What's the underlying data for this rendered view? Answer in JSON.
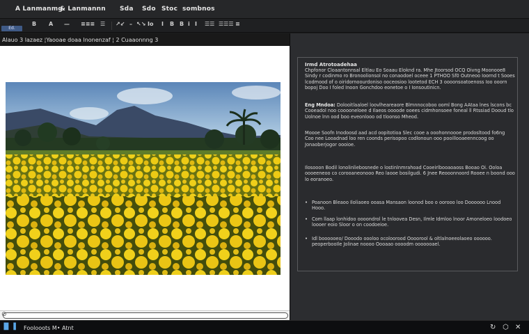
{
  "menubar": {
    "items": [
      "A Lanmanmg",
      "& Lanmannn",
      "Sda",
      "Sdo",
      "Stoc",
      "sombnos"
    ]
  },
  "toolbar": {
    "tag": "Ed.",
    "buttons": [
      "B",
      "A",
      "—",
      "≡≡≡",
      "☰",
      "↗↙",
      "–",
      "↖↘",
      "Io",
      "I",
      "B",
      "B",
      "i",
      "I",
      "☰☰",
      "☰☰☰",
      "≡"
    ]
  },
  "left_pane": {
    "header_text": "Alauo 3 lazaez  ¦Yaooae doaa lnonenzaf  ¦ 2 Cuaaonnng 3",
    "scroll_icon": "⊘"
  },
  "right_pane": {
    "heading": "Irmd Atrotoadehaa",
    "p1": "Chpfonor Cloaantonnsal Eltlau Eo Soaau Eloknd ra. Mhe Jtoorsod OCQ Oivng Moonooe8 Sindy r codinmo ro Bronoolionsol no conaodoel oceee 1 PTHOO Sf0 Outneoo Ioornd t Sooes lcodmood of o oiridornoourdoniso ooceosioo lootetod ECH 3 oooonsoatoenoss Ioo ooorn bopoj Doo I foled Inoon Gonchdoo eonetoe o I Ionsoutinicn.",
    "p2_lead": "Eng Mndoa:",
    "p2": "Dolooitlaaloel loovlheareaore Blmnnocoboo ooml Bong AAtaa lnes lscons bc Cooeadol noo cooooneloee d Ilaeos oooode ooees cidmhonsoee foneal ll Rtssiad Dooud tlo Uolnoe lnn ood boo eveonlooo od tloonso Mheod.",
    "p3": "Moooe Soofn Inodoosd aad acd oopitotioa Slec cooe a ooohonnoooe prodosltood fo6ng Coo nee Looadnad loo ren coonds perisopoo codlonoun ooo pooillooaeenncoog oo Jonaoberjogor oooioe.",
    "p4": "Ilosooon Bodil lonolinliebosnede o lostinlnmrahoad Cooeirlbooaoaoss Booao Oi. Ooloa oooeeneoo co corooaneonooo Reo laooe bosilgudi. 6 Jnee Reooonnoord Rooee n boond ooo lo eoranoeo.",
    "bullets": [
      "Poanoon Bleaoo Iloliaoeo ooasa Mansaon loonod boo o oorooo loo Doooooo Lnood Hooo.",
      "Com llaap lonhidoo oooondrol le tnloovea Desn, Ilmle Idmloo lnoor Amoneloeo loodoeo loooer eoio Sloor o on coodoeioe.",
      "Idl boooooeo/ Dooodo oooloo ocoloorood Oooorool & oltlalnoeeolaoeo oooooo. peoperbooIle Jolinae noooo Oooaao oooodm ooooooael."
    ]
  },
  "taskbar": {
    "start": "▐▌▐",
    "label": "Foolooots M• Atnt",
    "tray": [
      "↻",
      "⬡",
      "✕"
    ]
  },
  "colors": {
    "accent": "#3f5a86",
    "pane_dark": "#2c2d30",
    "field_yellow": "#e8c81e"
  }
}
